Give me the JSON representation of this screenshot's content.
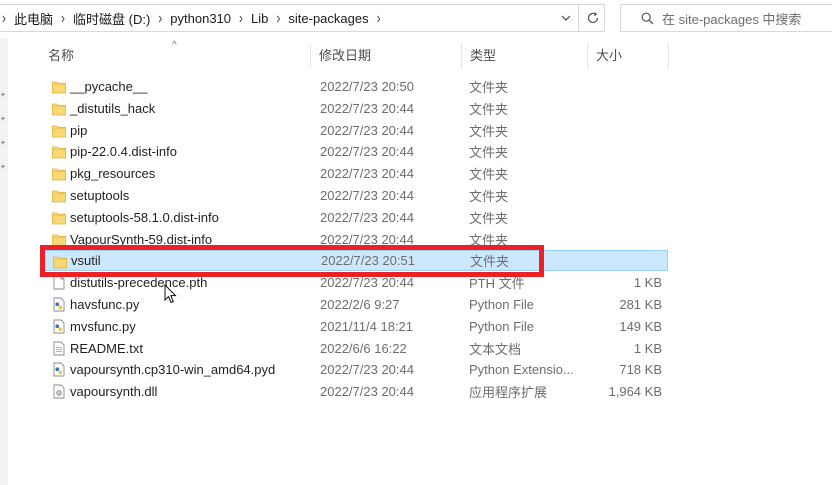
{
  "address": {
    "crumbs": [
      "此电脑",
      "临时磁盘 (D:)",
      "python310",
      "Lib",
      "site-packages"
    ]
  },
  "search": {
    "placeholder": "在 site-packages 中搜索"
  },
  "columns": {
    "name": "名称",
    "date": "修改日期",
    "type": "类型",
    "size": "大小"
  },
  "files": [
    {
      "name": "__pycache__",
      "date": "2022/7/23 20:50",
      "type": "文件夹",
      "size": "",
      "icon": "folder"
    },
    {
      "name": "_distutils_hack",
      "date": "2022/7/23 20:44",
      "type": "文件夹",
      "size": "",
      "icon": "folder"
    },
    {
      "name": "pip",
      "date": "2022/7/23 20:44",
      "type": "文件夹",
      "size": "",
      "icon": "folder"
    },
    {
      "name": "pip-22.0.4.dist-info",
      "date": "2022/7/23 20:44",
      "type": "文件夹",
      "size": "",
      "icon": "folder"
    },
    {
      "name": "pkg_resources",
      "date": "2022/7/23 20:44",
      "type": "文件夹",
      "size": "",
      "icon": "folder"
    },
    {
      "name": "setuptools",
      "date": "2022/7/23 20:44",
      "type": "文件夹",
      "size": "",
      "icon": "folder"
    },
    {
      "name": "setuptools-58.1.0.dist-info",
      "date": "2022/7/23 20:44",
      "type": "文件夹",
      "size": "",
      "icon": "folder"
    },
    {
      "name": "VapourSynth-59.dist-info",
      "date": "2022/7/23 20:44",
      "type": "文件夹",
      "size": "",
      "icon": "folder"
    },
    {
      "name": "vsutil",
      "date": "2022/7/23 20:51",
      "type": "文件夹",
      "size": "",
      "icon": "folder",
      "selected": true
    },
    {
      "name": "distutils-precedence.pth",
      "date": "2022/7/23 20:44",
      "type": "PTH 文件",
      "size": "1 KB",
      "icon": "file"
    },
    {
      "name": "havsfunc.py",
      "date": "2022/2/6 9:27",
      "type": "Python File",
      "size": "281 KB",
      "icon": "python"
    },
    {
      "name": "mvsfunc.py",
      "date": "2021/11/4 18:21",
      "type": "Python File",
      "size": "149 KB",
      "icon": "python"
    },
    {
      "name": "README.txt",
      "date": "2022/6/6 16:22",
      "type": "文本文档",
      "size": "1 KB",
      "icon": "text"
    },
    {
      "name": "vapoursynth.cp310-win_amd64.pyd",
      "date": "2022/7/23 20:44",
      "type": "Python Extensio...",
      "size": "718 KB",
      "icon": "python"
    },
    {
      "name": "vapoursynth.dll",
      "date": "2022/7/23 20:44",
      "type": "应用程序扩展",
      "size": "1,964 KB",
      "icon": "dll"
    }
  ],
  "colors": {
    "selection": "#cce8ff",
    "highlight": "#ec2127",
    "folder": "#f8d775"
  }
}
